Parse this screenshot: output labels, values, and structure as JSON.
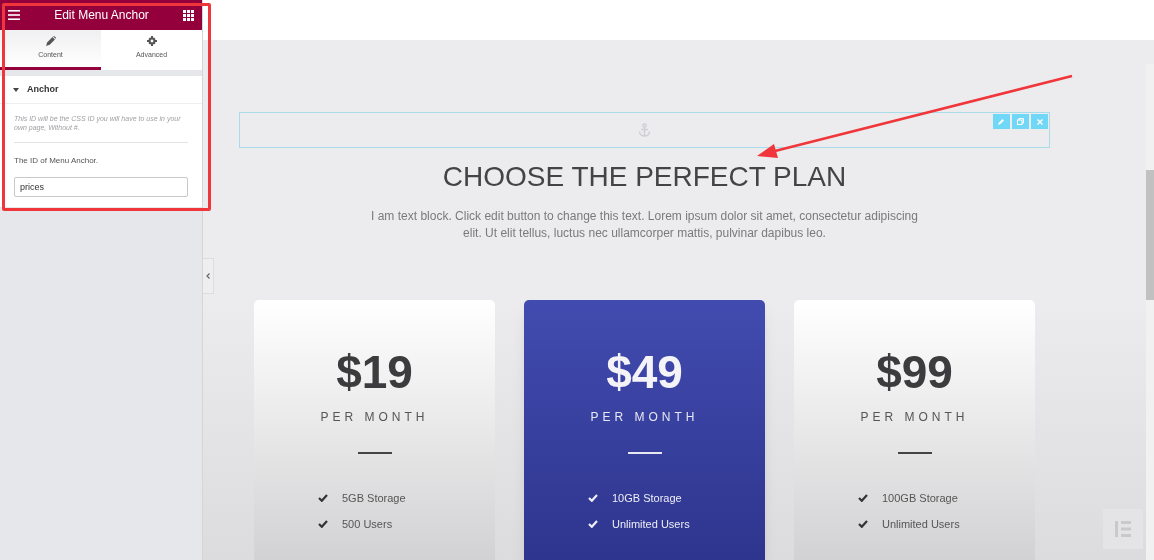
{
  "panel": {
    "title": "Edit Menu Anchor",
    "tabs": [
      {
        "label": "Content",
        "selected": true
      },
      {
        "label": "Advanced",
        "selected": false
      }
    ],
    "section": {
      "label": "Anchor",
      "expanded": true
    },
    "description": "This ID will be the CSS ID you will have to use in your own page, Without #.",
    "field": {
      "label": "The ID of Menu Anchor.",
      "value": "prices"
    }
  },
  "canvas": {
    "heading": "CHOOSE THE PERFECT PLAN",
    "paragraph": "I am text block. Click edit button to change this text. Lorem ipsum dolor sit amet, consectetur adipiscing elit. Ut elit tellus, luctus nec ullamcorper mattis, pulvinar dapibus leo.",
    "plans": [
      {
        "price": "$19",
        "period": "PER MONTH",
        "featured": false,
        "features": [
          "5GB Storage",
          "500 Users"
        ]
      },
      {
        "price": "$49",
        "period": "PER MONTH",
        "featured": true,
        "features": [
          "10GB Storage",
          "Unlimited Users"
        ]
      },
      {
        "price": "$99",
        "period": "PER MONTH",
        "featured": false,
        "features": [
          "100GB Storage",
          "Unlimited Users"
        ]
      }
    ]
  }
}
